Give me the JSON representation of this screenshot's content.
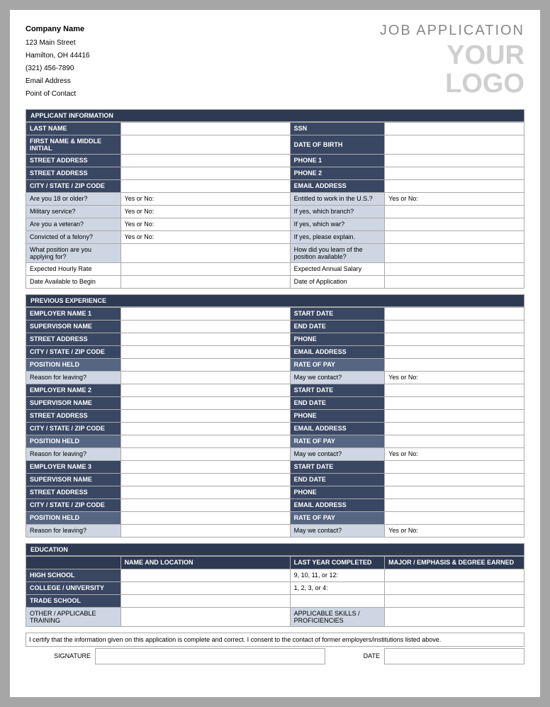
{
  "header": {
    "company": "Company Name",
    "street": "123 Main Street",
    "city": "Hamilton, OH 44416",
    "phone": "(321) 456-7890",
    "email": "Email Address",
    "contact": "Point of Contact",
    "title": "JOB APPLICATION",
    "logo1": "YOUR",
    "logo2": "LOGO"
  },
  "sec": {
    "applicant": "APPLICANT INFORMATION",
    "prev": "PREVIOUS EXPERIENCE",
    "edu": "EDUCATION"
  },
  "app": {
    "last": "LAST NAME",
    "ssn": "SSN",
    "first": "FIRST NAME & MIDDLE INITIAL",
    "dob": "DATE OF BIRTH",
    "addr1": "STREET ADDRESS",
    "phone1": "PHONE 1",
    "addr2": "STREET ADDRESS",
    "phone2": "PHONE 2",
    "city": "CITY / STATE / ZIP CODE",
    "emailaddr": "EMAIL ADDRESS",
    "q18": "Are you 18 or older?",
    "yn": "Yes or No:",
    "qus": "Entitled to work in the U.S.?",
    "mil": "Military service?",
    "branch": "If yes, which branch?",
    "vet": "Are you a veteran?",
    "war": "If yes, which war?",
    "felony": "Convicted of a felony?",
    "explain": "If yes, please explain.",
    "position": "What position are you applying for?",
    "learn": "How did you learn of the position available?",
    "hourly": "Expected Hourly Rate",
    "annual": "Expected Annual Salary",
    "avail": "Date Available to Begin",
    "doa": "Date of Application"
  },
  "exp": {
    "emp1": "EMPLOYER NAME 1",
    "emp2": "EMPLOYER NAME 2",
    "emp3": "EMPLOYER NAME 3",
    "sup": "SUPERVISOR NAME",
    "addr": "STREET ADDRESS",
    "city": "CITY / STATE / ZIP CODE",
    "pos": "POSITION HELD",
    "start": "START DATE",
    "end": "END DATE",
    "phone": "PHONE",
    "email": "EMAIL ADDRESS",
    "rate": "RATE OF PAY",
    "reason": "Reason for leaving?",
    "contact": "May we contact?",
    "yn": "Yes or No:"
  },
  "edu": {
    "nameloc": "NAME AND LOCATION",
    "lastyear": "LAST YEAR COMPLETED",
    "major": "MAJOR / EMPHASIS & DEGREE EARNED",
    "hs": "HIGH SCHOOL",
    "hsyrs": "9, 10, 11, or 12:",
    "col": "COLLEGE / UNIVERSITY",
    "colyrs": "1, 2, 3, or 4:",
    "trade": "TRADE SCHOOL",
    "other": "OTHER / APPLICABLE TRAINING",
    "skills": "APPLICABLE SKILLS / PROFICIENCIES"
  },
  "cert": "I certify that the information given on this application is complete and correct. I consent to the contact of former employers/institutions  listed above.",
  "sig": {
    "signature": "SIGNATURE",
    "date": "DATE"
  }
}
